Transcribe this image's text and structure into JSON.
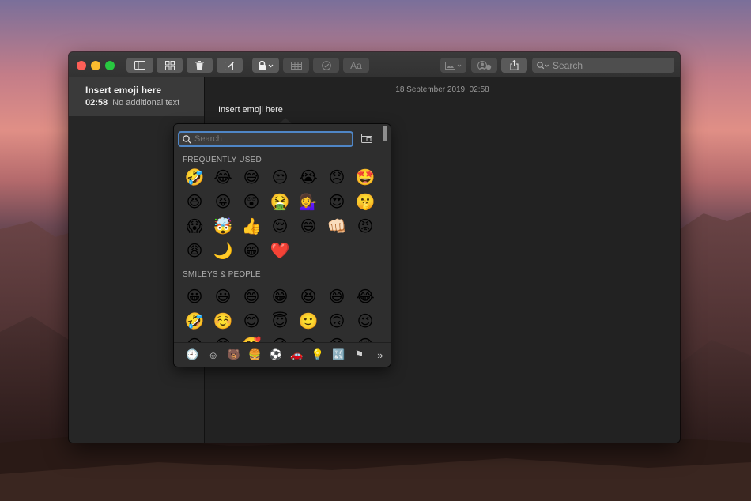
{
  "toolbar": {
    "format_label": "Aa",
    "search_placeholder": "Search"
  },
  "sidebar": {
    "notes": [
      {
        "title": "Insert emoji here",
        "time": "02:58",
        "preview": "No additional text"
      }
    ]
  },
  "editor": {
    "date": "18 September 2019, 02:58",
    "text": "Insert emoji here"
  },
  "emoji_picker": {
    "search_placeholder": "Search",
    "sections": [
      {
        "label": "FREQUENTLY USED",
        "emojis": [
          "🤣",
          "😂",
          "😅",
          "😒",
          "😭",
          "😞",
          "🤩",
          "😆",
          "😝",
          "😲",
          "🤮",
          "💁‍♀️",
          "😍",
          "🤫",
          "😱",
          "🤯",
          "👍",
          "😌",
          "😄",
          "👊🏻",
          "😡",
          "😩",
          "🌙",
          "😁",
          "❤️"
        ]
      },
      {
        "label": "SMILEYS & PEOPLE",
        "emojis": [
          "😀",
          "😃",
          "😄",
          "😁",
          "😆",
          "😅",
          "😂",
          "🤣",
          "☺️",
          "😊",
          "😇",
          "🙂",
          "🙃",
          "😉",
          "😌",
          "😍",
          "🥰",
          "😘",
          "😗",
          "😙",
          "😚"
        ]
      }
    ],
    "categories": [
      {
        "name": "frequently-used",
        "glyph": "🕘"
      },
      {
        "name": "smileys",
        "glyph": "☺"
      },
      {
        "name": "animals",
        "glyph": "🐻"
      },
      {
        "name": "food",
        "glyph": "🍔"
      },
      {
        "name": "activity",
        "glyph": "⚽"
      },
      {
        "name": "travel",
        "glyph": "🚗"
      },
      {
        "name": "objects",
        "glyph": "💡"
      },
      {
        "name": "symbols",
        "glyph": "🔣"
      },
      {
        "name": "flags",
        "glyph": "⚑"
      },
      {
        "name": "more",
        "glyph": "»"
      }
    ]
  }
}
